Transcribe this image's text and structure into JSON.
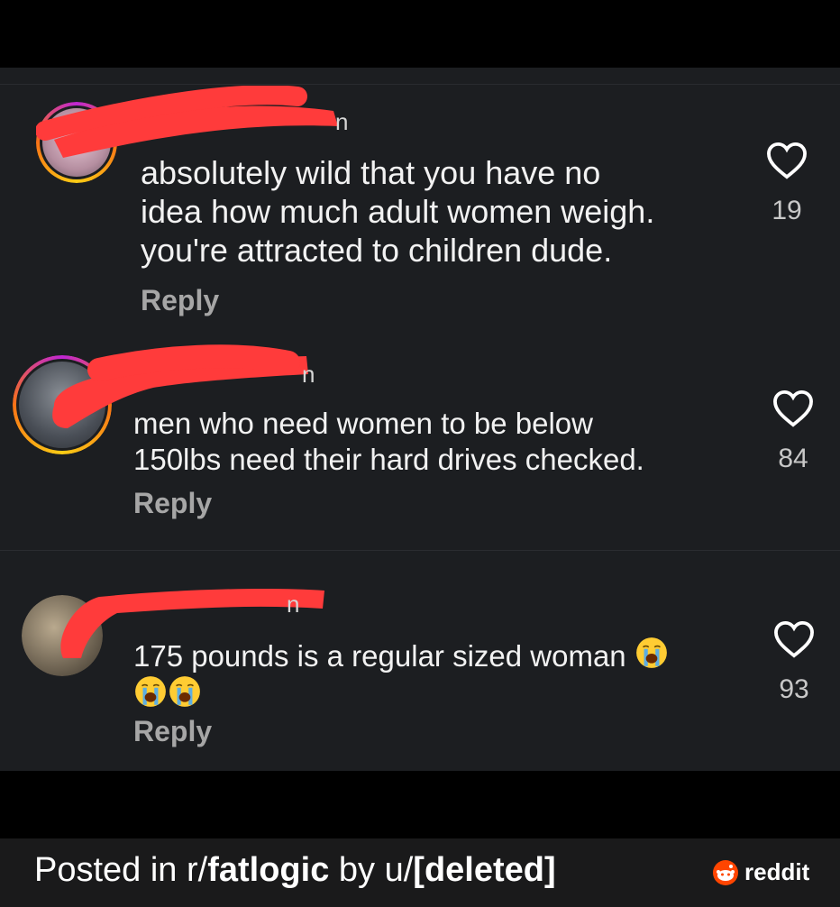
{
  "comments": [
    {
      "username_tail": "n",
      "text": "absolutely wild that you have no\nidea how much adult women weigh.\nyou're attracted to children dude.",
      "reply_label": "Reply",
      "likes": "19",
      "avatar_icon": "profile-photo"
    },
    {
      "username_tail": "n",
      "text": "men who need women to be below\n150lbs need their hard drives checked.",
      "reply_label": "Reply",
      "likes": "84",
      "avatar_icon": "profile-photo"
    },
    {
      "username_tail": "n",
      "text_line1": "175 pounds is a regular sized woman",
      "reply_label": "Reply",
      "likes": "93",
      "emoji": "loudly-crying-face",
      "avatar_icon": "profile-photo"
    }
  ],
  "footer": {
    "prefix": "Posted in r/",
    "subreddit": "fatlogic",
    "middle": " by u/",
    "user": "[deleted]",
    "brand": "reddit"
  },
  "colors": {
    "panel_bg": "#1c1e21",
    "redaction": "#ff3b3b",
    "reply_gray": "#a6a6a6"
  }
}
